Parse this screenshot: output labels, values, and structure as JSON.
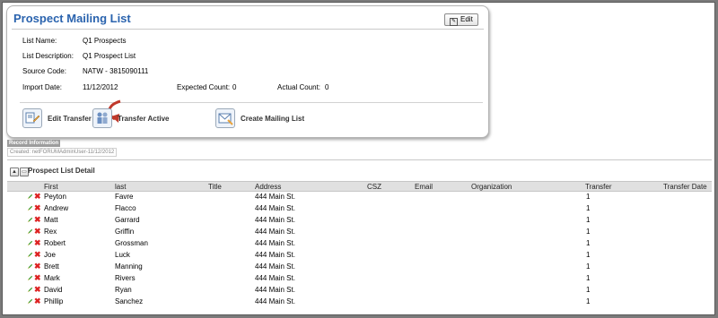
{
  "card": {
    "title": "Prospect Mailing List",
    "edit_label": "Edit",
    "fields": {
      "list_name_label": "List Name:",
      "list_name": "Q1 Prospects",
      "list_desc_label": "List Description:",
      "list_desc": "Q1 Prospect List",
      "source_code_label": "Source Code:",
      "source_code": "NATW - 3815090111",
      "import_date_label": "Import Date:",
      "import_date": "11/12/2012",
      "expected_label": "Expected Count:",
      "expected": "0",
      "actual_label": "Actual Count:",
      "actual": "0"
    },
    "actions": {
      "edit_transfer": "Edit Transfer",
      "transfer_active": "Transfer Active",
      "create_mailing": "Create Mailing List"
    }
  },
  "record": {
    "header": "Record Information",
    "created": "Created: netFORUMAdminUser-11/12/2012"
  },
  "detail": {
    "title": "Prospect List Detail",
    "columns": {
      "first": "First",
      "last": "last",
      "title": "Title",
      "address": "Address",
      "csz": "CSZ",
      "email": "Email",
      "organization": "Organization",
      "transfer": "Transfer",
      "transfer_date": "Transfer Date"
    },
    "rows": [
      {
        "first": "Peyton",
        "last": "Favre",
        "address": "444 Main St.",
        "transfer": "1"
      },
      {
        "first": "Andrew",
        "last": "Flacco",
        "address": "444 Main St.",
        "transfer": "1"
      },
      {
        "first": "Matt",
        "last": "Garrard",
        "address": "444 Main St.",
        "transfer": "1"
      },
      {
        "first": "Rex",
        "last": "Griffin",
        "address": "444 Main St.",
        "transfer": "1"
      },
      {
        "first": "Robert",
        "last": "Grossman",
        "address": "444 Main St.",
        "transfer": "1"
      },
      {
        "first": "Joe",
        "last": "Luck",
        "address": "444 Main St.",
        "transfer": "1"
      },
      {
        "first": "Brett",
        "last": "Manning",
        "address": "444 Main St.",
        "transfer": "1"
      },
      {
        "first": "Mark",
        "last": "Rivers",
        "address": "444 Main St.",
        "transfer": "1"
      },
      {
        "first": "David",
        "last": "Ryan",
        "address": "444 Main St.",
        "transfer": "1"
      },
      {
        "first": "Phillip",
        "last": "Sanchez",
        "address": "444 Main St.",
        "transfer": "1"
      }
    ]
  },
  "colors": {
    "title_blue": "#2a63ae",
    "delete_red": "#dd2222",
    "pencil_green": "#3a9a2a",
    "header_gray": "#e0e0e0",
    "callout_arrow": "#c0392b"
  }
}
